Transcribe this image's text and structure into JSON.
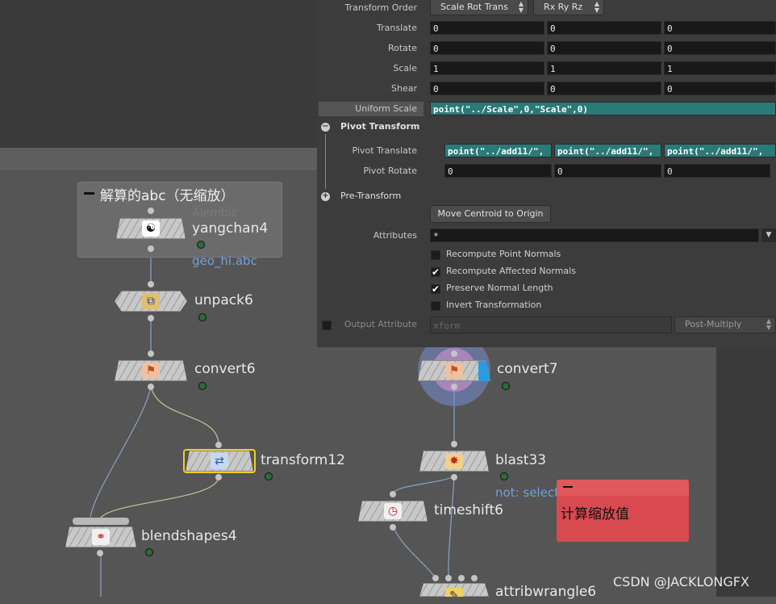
{
  "parameters": {
    "transform_order": {
      "label": "Transform Order",
      "order_value": "Scale Rot Trans",
      "rot_value": "Rx Ry Rz"
    },
    "translate": {
      "label": "Translate",
      "values": [
        "0",
        "0",
        "0"
      ]
    },
    "rotate": {
      "label": "Rotate",
      "values": [
        "0",
        "0",
        "0"
      ]
    },
    "scale": {
      "label": "Scale",
      "values": [
        "1",
        "1",
        "1"
      ]
    },
    "shear": {
      "label": "Shear",
      "values": [
        "0",
        "0",
        "0"
      ]
    },
    "uniform_scale": {
      "label": "Uniform Scale",
      "value": "point(\"../Scale\",0,\"Scale\",0)"
    },
    "pivot_section": {
      "title": "Pivot Transform"
    },
    "pivot_translate": {
      "label": "Pivot Translate",
      "values": [
        "point(\"../add11/\",",
        "point(\"../add11/\",",
        "point(\"../add11/\","
      ]
    },
    "pivot_rotate": {
      "label": "Pivot Rotate",
      "values": [
        "0",
        "0",
        "0"
      ]
    },
    "pre_transform": {
      "title": "Pre-Transform"
    },
    "move_centroid_button": "Move Centroid to Origin",
    "attributes": {
      "label": "Attributes",
      "value": "*"
    },
    "checkboxes": [
      {
        "label": "Recompute Point Normals",
        "checked": false
      },
      {
        "label": "Recompute Affected Normals",
        "checked": true
      },
      {
        "label": "Preserve Normal Length",
        "checked": true
      },
      {
        "label": "Invert Transformation",
        "checked": false
      }
    ],
    "output_attribute": {
      "label": "Output Attribute",
      "placeholder": "xform",
      "mode": "Post-Multiply"
    }
  },
  "network": {
    "netbox_title": "解算的abc（无缩放）",
    "nodes": {
      "yangchan4": {
        "name": "yangchan4",
        "type_label": "Alembic",
        "subtitle": "geo_hi.abc"
      },
      "unpack6": {
        "name": "unpack6"
      },
      "convert6": {
        "name": "convert6"
      },
      "transform12": {
        "name": "transform12"
      },
      "blendshapes4": {
        "name": "blendshapes4"
      },
      "convert7": {
        "name": "convert7"
      },
      "blast33": {
        "name": "blast33",
        "subtitle": "not: selection"
      },
      "timeshift6": {
        "name": "timeshift6"
      },
      "attribwrangle6": {
        "name": "attribwrangle6"
      }
    },
    "sticky_note": "计算缩放值"
  },
  "watermark": "CSDN @JACKLONGFX",
  "colors": {
    "expression_field": "#2a7a78",
    "sticky_note": "#d84a4f",
    "selected_node_outline": "#f0d020",
    "subtitle_blue": "#6fa0dc"
  },
  "icons": {
    "arrows": "▲▼",
    "check": "✔"
  }
}
